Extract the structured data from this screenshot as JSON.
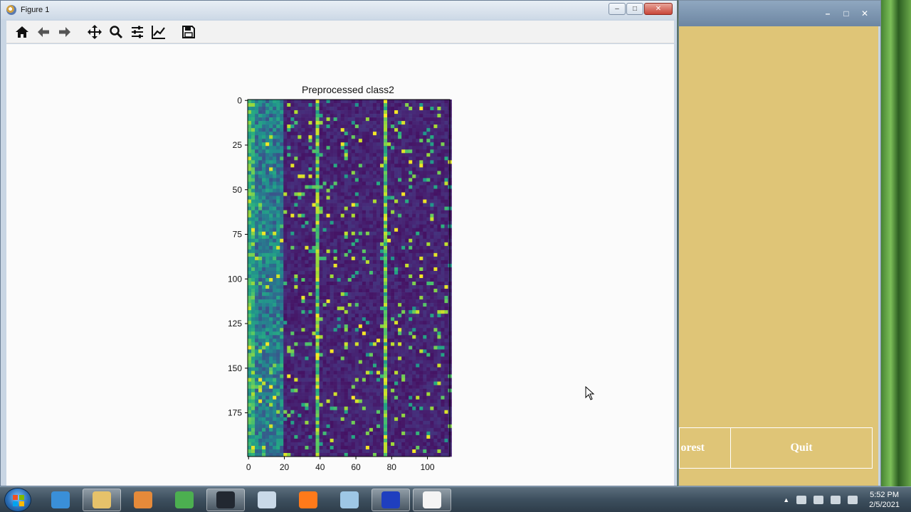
{
  "figure_window": {
    "title": "Figure 1",
    "controls": {
      "minimize": "–",
      "maximize": "□",
      "close": "✕"
    },
    "toolbar": [
      {
        "icon": "home-icon"
      },
      {
        "icon": "back-arrow-icon"
      },
      {
        "icon": "forward-arrow-icon"
      },
      {
        "icon": "pan-icon"
      },
      {
        "icon": "zoom-icon"
      },
      {
        "icon": "configure-subplots-icon"
      },
      {
        "icon": "edit-axis-icon"
      },
      {
        "icon": "save-icon"
      }
    ]
  },
  "chart_data": {
    "type": "heatmap",
    "title": "Preprocessed class2",
    "x_ticks": [
      0,
      20,
      40,
      60,
      80,
      100
    ],
    "y_ticks": [
      0,
      25,
      50,
      75,
      100,
      125,
      150,
      175
    ],
    "xlim": [
      0,
      113
    ],
    "ylim": [
      200,
      0
    ],
    "rows": 200,
    "cols": 113,
    "colormap": "viridis",
    "bright_columns": [
      38,
      76
    ]
  },
  "app_window": {
    "controls": {
      "minimize": "–",
      "maximize": "□",
      "close": "✕"
    },
    "buttons": {
      "left_partial": "orest",
      "right": "Quit"
    },
    "bg_color": "#dfc577"
  },
  "taskbar": {
    "items": [
      {
        "icon": "internet-explorer-icon",
        "color": "#3a8fd8"
      },
      {
        "icon": "file-explorer-icon",
        "color": "#e6c26a"
      },
      {
        "icon": "media-player-icon",
        "color": "#e58a3a"
      },
      {
        "icon": "chrome-icon",
        "color": "#4caf50"
      },
      {
        "icon": "terminal-icon",
        "color": "#222831"
      },
      {
        "icon": "paint-icon",
        "color": "#c9d9e8"
      },
      {
        "icon": "firefox-icon",
        "color": "#ff7a1a"
      },
      {
        "icon": "notes-icon",
        "color": "#9ec7e6"
      },
      {
        "icon": "python-figure-icon",
        "color": "#1f3fbf"
      },
      {
        "icon": "blank-document-icon",
        "color": "#f4f4f4"
      }
    ],
    "clock": {
      "time": "5:52 PM",
      "date": "2/5/2021"
    }
  }
}
